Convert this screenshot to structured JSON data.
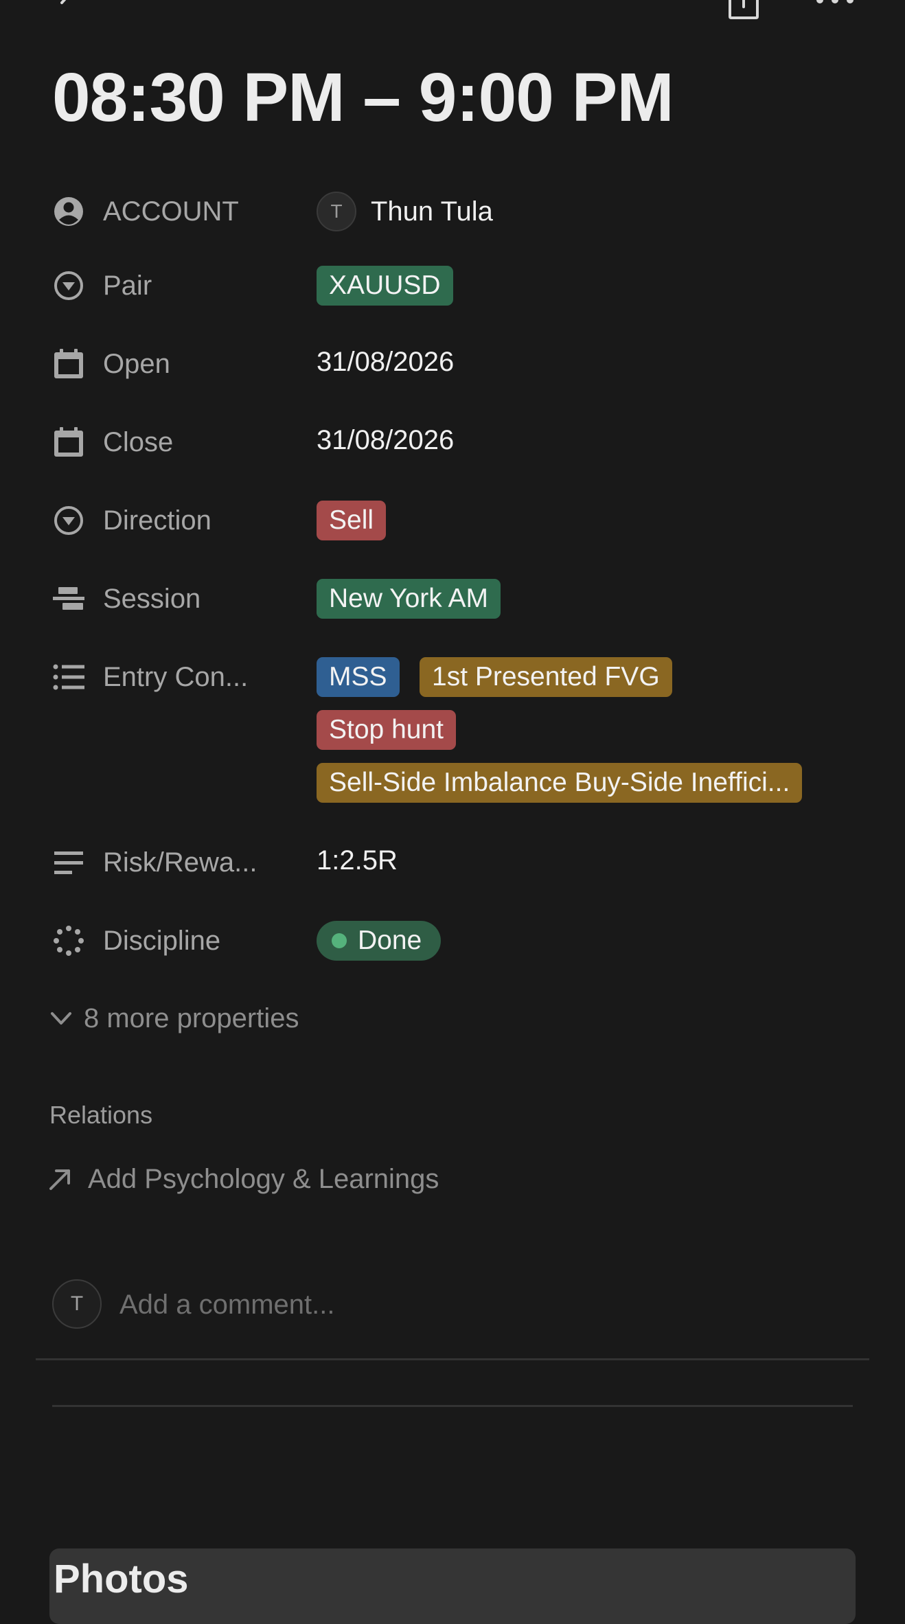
{
  "page": {
    "title": "08:30 PM – 9:00 PM"
  },
  "topbar": {
    "back_icon": "chevron-left-icon",
    "share_icon": "share-icon",
    "more_icon": "ellipsis-icon"
  },
  "properties": {
    "account": {
      "label": "ACCOUNT",
      "avatar_initial": "T",
      "value": "Thun Tula",
      "icon": "person-circle-icon"
    },
    "pair": {
      "label": "Pair",
      "value": "XAUUSD",
      "icon": "select-circle-icon",
      "color": "#2f6b4e"
    },
    "open": {
      "label": "Open",
      "value": "31/08/2026",
      "icon": "calendar-icon"
    },
    "close": {
      "label": "Close",
      "value": "31/08/2026",
      "icon": "calendar-icon"
    },
    "direction": {
      "label": "Direction",
      "value": "Sell",
      "icon": "select-circle-icon",
      "color": "#a44a4a"
    },
    "session": {
      "label": "Session",
      "value": "New York AM",
      "icon": "align-bars-icon",
      "color": "#2f6b4e"
    },
    "entry": {
      "label": "Entry Con...",
      "icon": "list-icon",
      "tags": [
        {
          "text": "MSS",
          "color": "#2f5f92"
        },
        {
          "text": "1st Presented FVG",
          "color": "#8a6722"
        },
        {
          "text": "Stop hunt",
          "color": "#a44a4a"
        },
        {
          "text": "Sell-Side Imbalance Buy-Side Ineffici...",
          "color": "#8a6722"
        }
      ]
    },
    "risk": {
      "label": "Risk/Rewa...",
      "value": "1:2.5R",
      "icon": "text-lines-icon"
    },
    "discipline": {
      "label": "Discipline",
      "value": "Done",
      "icon": "status-spinner-icon",
      "color": "#2f5d45",
      "dot_color": "#55b27c"
    }
  },
  "more_properties": {
    "label": "8 more properties",
    "icon": "chevron-down-icon"
  },
  "relations": {
    "heading": "Relations",
    "add_label": "Add Psychology & Learnings",
    "icon": "arrow-up-right-icon"
  },
  "comment": {
    "avatar_initial": "T",
    "placeholder": "Add a comment..."
  },
  "photos": {
    "heading": "Photos"
  }
}
